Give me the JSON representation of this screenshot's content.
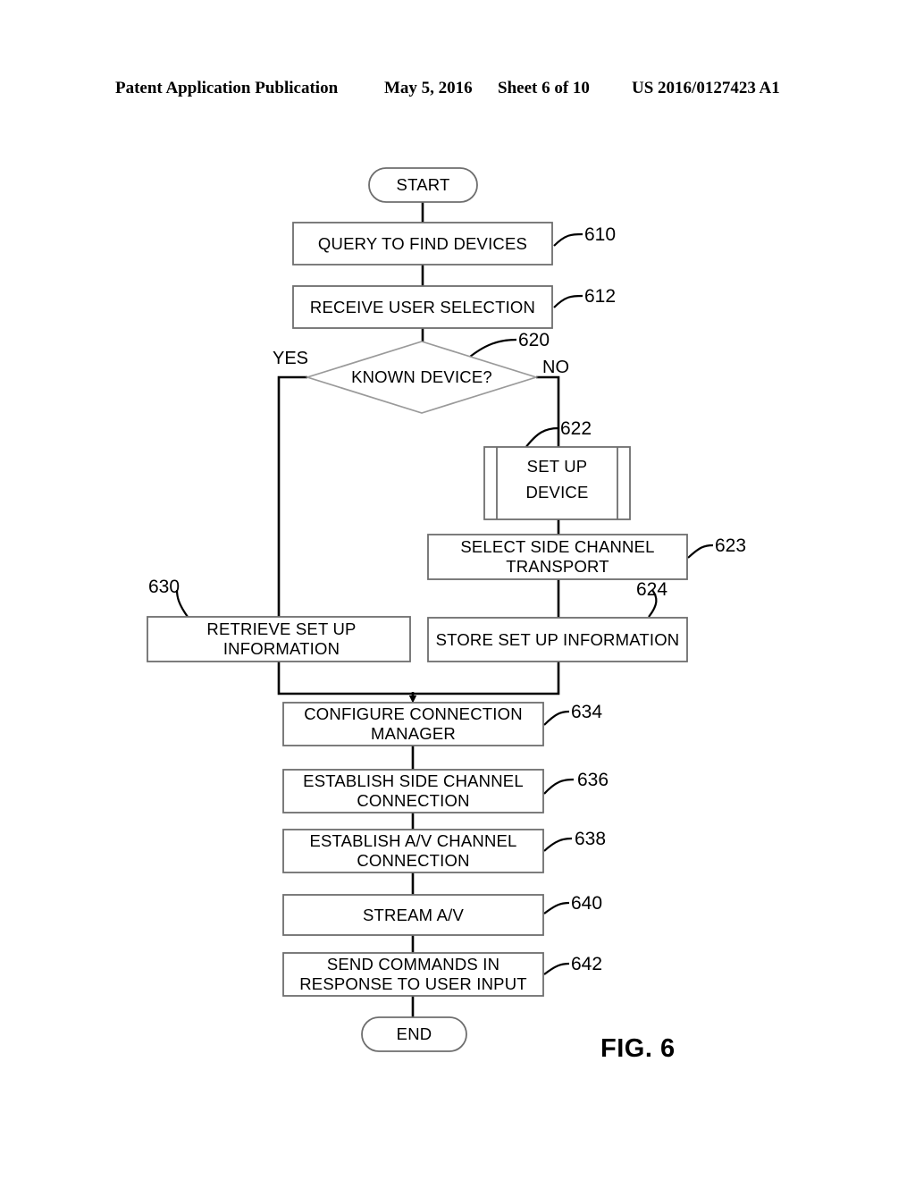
{
  "header": {
    "publication": "Patent Application Publication",
    "date": "May 5, 2016",
    "sheet": "Sheet 6 of 10",
    "patent_number": "US 2016/0127423 A1"
  },
  "figure": {
    "caption": "FIG. 6"
  },
  "chart_data": {
    "type": "diagram",
    "title": "FIG. 6",
    "diagram_kind": "flowchart",
    "nodes": [
      {
        "id": "start",
        "shape": "terminator",
        "label": "START",
        "ref": null
      },
      {
        "id": "610",
        "shape": "process",
        "label": "QUERY TO FIND DEVICES",
        "ref": "610"
      },
      {
        "id": "612",
        "shape": "process",
        "label": "RECEIVE USER SELECTION",
        "ref": "612"
      },
      {
        "id": "620",
        "shape": "decision",
        "label": "KNOWN DEVICE?",
        "ref": "620"
      },
      {
        "id": "622",
        "shape": "predefined-process",
        "label": "SET UP DEVICE",
        "ref": "622"
      },
      {
        "id": "623",
        "shape": "process",
        "label": "SELECT SIDE CHANNEL TRANSPORT",
        "ref": "623"
      },
      {
        "id": "624",
        "shape": "process",
        "label": "STORE SET UP INFORMATION",
        "ref": "624"
      },
      {
        "id": "630",
        "shape": "process",
        "label": "RETRIEVE SET UP INFORMATION",
        "ref": "630"
      },
      {
        "id": "634",
        "shape": "process",
        "label": "CONFIGURE CONNECTION MANAGER",
        "ref": "634"
      },
      {
        "id": "636",
        "shape": "process",
        "label": "ESTABLISH SIDE CHANNEL CONNECTION",
        "ref": "636"
      },
      {
        "id": "638",
        "shape": "process",
        "label": "ESTABLISH A/V CHANNEL CONNECTION",
        "ref": "638"
      },
      {
        "id": "640",
        "shape": "process",
        "label": "STREAM A/V",
        "ref": "640"
      },
      {
        "id": "642",
        "shape": "process",
        "label": "SEND COMMANDS IN RESPONSE TO USER INPUT",
        "ref": "642"
      },
      {
        "id": "end",
        "shape": "terminator",
        "label": "END",
        "ref": null
      }
    ],
    "edges": [
      {
        "from": "start",
        "to": "610",
        "label": ""
      },
      {
        "from": "610",
        "to": "612",
        "label": ""
      },
      {
        "from": "612",
        "to": "620",
        "label": ""
      },
      {
        "from": "620",
        "to": "630",
        "label": "YES"
      },
      {
        "from": "620",
        "to": "622",
        "label": "NO"
      },
      {
        "from": "622",
        "to": "623",
        "label": ""
      },
      {
        "from": "623",
        "to": "624",
        "label": ""
      },
      {
        "from": "630",
        "to": "634",
        "label": ""
      },
      {
        "from": "624",
        "to": "634",
        "label": ""
      },
      {
        "from": "634",
        "to": "636",
        "label": ""
      },
      {
        "from": "636",
        "to": "638",
        "label": ""
      },
      {
        "from": "638",
        "to": "640",
        "label": ""
      },
      {
        "from": "640",
        "to": "642",
        "label": ""
      },
      {
        "from": "642",
        "to": "end",
        "label": ""
      }
    ],
    "branch_labels": {
      "yes": "YES",
      "no": "NO"
    }
  },
  "nodes": {
    "start_label": "START",
    "n610_label": "QUERY TO FIND DEVICES",
    "n612_label": "RECEIVE USER SELECTION",
    "n620_label": "KNOWN DEVICE?",
    "n622_label_line1": "SET UP",
    "n622_label_line2": "DEVICE",
    "n623_label": "SELECT SIDE CHANNEL TRANSPORT",
    "n624_label": "STORE SET UP INFORMATION",
    "n630_label": "RETRIEVE SET UP INFORMATION",
    "n634_label": "CONFIGURE CONNECTION MANAGER",
    "n636_label": "ESTABLISH SIDE CHANNEL CONNECTION",
    "n638_label": "ESTABLISH A/V CHANNEL CONNECTION",
    "n640_label": "STREAM A/V",
    "n642_label": "SEND COMMANDS IN RESPONSE TO USER INPUT",
    "end_label": "END"
  },
  "refs": {
    "r610": "610",
    "r612": "612",
    "r620": "620",
    "r622": "622",
    "r623": "623",
    "r624": "624",
    "r630": "630",
    "r634": "634",
    "r636": "636",
    "r638": "638",
    "r640": "640",
    "r642": "642"
  },
  "branch": {
    "yes": "YES",
    "no": "NO"
  },
  "colors": {
    "ink": "#000000",
    "box_stroke": "#6e6e6e",
    "connector": "#000000",
    "background": "#ffffff"
  }
}
